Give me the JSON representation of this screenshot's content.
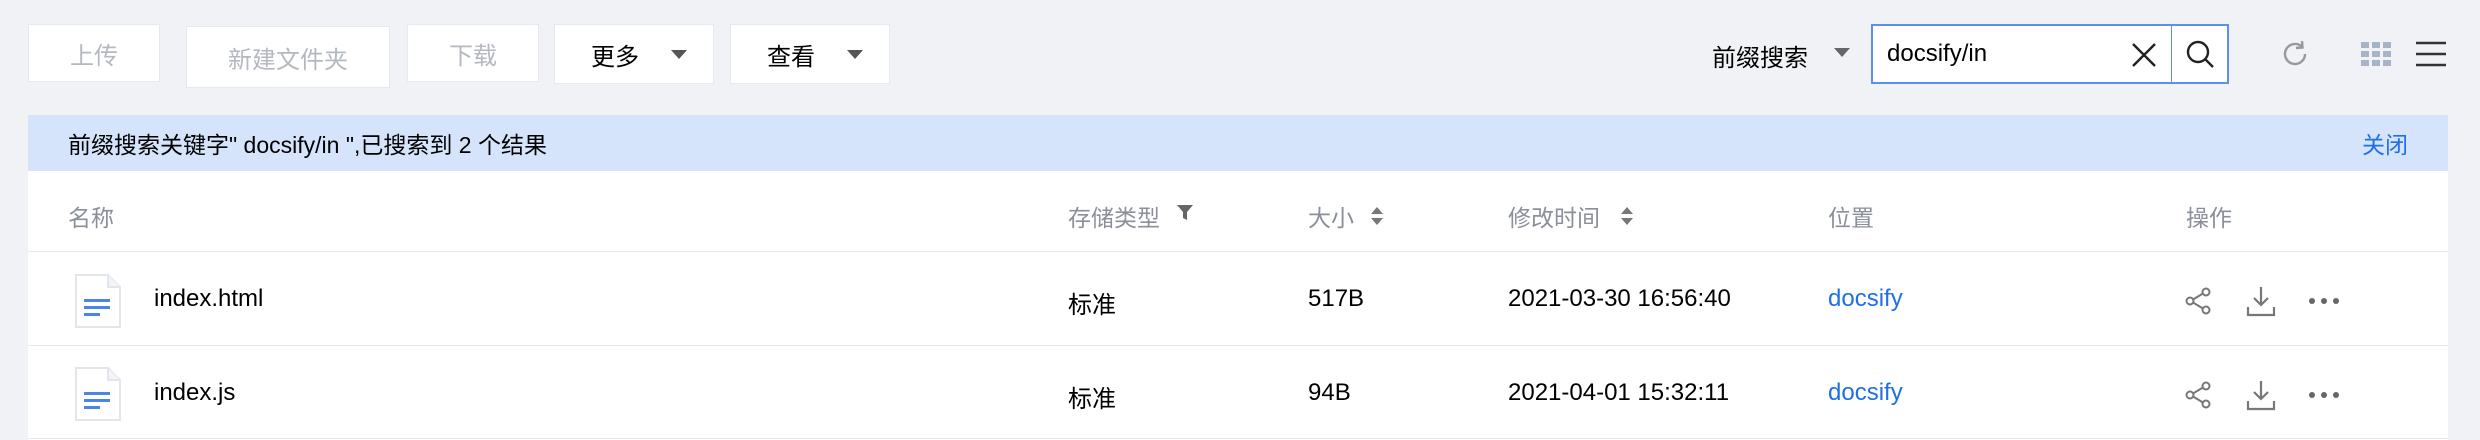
{
  "toolbar": {
    "upload_label": "上传",
    "new_folder_label": "新建文件夹",
    "download_label": "下载",
    "more_label": "更多",
    "view_label": "查看"
  },
  "search": {
    "mode_label": "前缀搜索",
    "value": "docsify/in"
  },
  "banner": {
    "text": "前缀搜索关键字\" docsify/in \",已搜索到 2 个结果",
    "close_label": "关闭"
  },
  "table": {
    "headers": {
      "name": "名称",
      "storage_type": "存储类型",
      "size": "大小",
      "modified": "修改时间",
      "location": "位置",
      "actions": "操作"
    },
    "rows": [
      {
        "name": "index.html",
        "storage_type": "标准",
        "size": "517B",
        "modified": "2021-03-30 16:56:40",
        "location": "docsify"
      },
      {
        "name": "index.js",
        "storage_type": "标准",
        "size": "94B",
        "modified": "2021-04-01 15:32:11",
        "location": "docsify"
      }
    ]
  },
  "colors": {
    "accent": "#1f6fe5",
    "banner_bg": "#d6e4fb",
    "page_bg": "#f0f2f5",
    "file_icon": "#4a86e8"
  },
  "icons": [
    "clear-icon",
    "search-icon",
    "refresh-icon",
    "grid-view-icon",
    "list-view-icon",
    "filter-icon",
    "sort-icon",
    "file-icon",
    "share-icon",
    "download-icon",
    "more-icon"
  ]
}
